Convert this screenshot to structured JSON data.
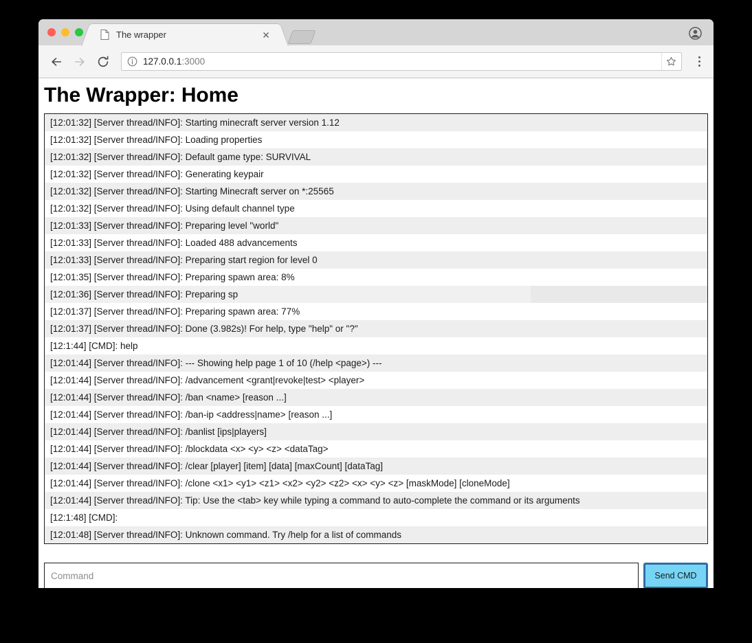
{
  "browser": {
    "tab": {
      "title": "The wrapper",
      "favicon": "document-icon",
      "close": "close-icon"
    },
    "new_tab_label": "new-tab-button",
    "profile": "profile-avatar-icon",
    "nav": {
      "back": "back-arrow-icon",
      "forward": "forward-arrow-icon",
      "reload": "reload-icon"
    },
    "omnibox": {
      "site_info": "info-circle-icon",
      "url_host": "127.0.0.1",
      "url_port": ":3000",
      "bookmark": "star-icon"
    },
    "menu": "three-dot-menu-icon"
  },
  "page": {
    "title": "The Wrapper: Home",
    "console_lines": [
      "[12:01:32] [Server thread/INFO]: Starting minecraft server version 1.12",
      "[12:01:32] [Server thread/INFO]: Loading properties",
      "[12:01:32] [Server thread/INFO]: Default game type: SURVIVAL",
      "[12:01:32] [Server thread/INFO]: Generating keypair",
      "[12:01:32] [Server thread/INFO]: Starting Minecraft server on *:25565",
      "[12:01:32] [Server thread/INFO]: Using default channel type",
      "[12:01:33] [Server thread/INFO]: Preparing level \"world\"",
      "[12:01:33] [Server thread/INFO]: Loaded 488 advancements",
      "[12:01:33] [Server thread/INFO]: Preparing start region for level 0",
      "[12:01:35] [Server thread/INFO]: Preparing spawn area: 8%",
      "[12:01:36] [Server thread/INFO]: Preparing sp",
      "[12:01:37] [Server thread/INFO]: Preparing spawn area: 77%",
      "[12:01:37] [Server thread/INFO]: Done (3.982s)! For help, type \"help\" or \"?\"",
      "[12:1:44] [CMD]: help",
      "[12:01:44] [Server thread/INFO]: --- Showing help page 1 of 10 (/help <page>) ---",
      "[12:01:44] [Server thread/INFO]: /advancement <grant|revoke|test> <player>",
      "[12:01:44] [Server thread/INFO]: /ban <name> [reason ...]",
      "[12:01:44] [Server thread/INFO]: /ban-ip <address|name> [reason ...]",
      "[12:01:44] [Server thread/INFO]: /banlist [ips|players]",
      "[12:01:44] [Server thread/INFO]: /blockdata <x> <y> <z> <dataTag>",
      "[12:01:44] [Server thread/INFO]: /clear [player] [item] [data] [maxCount] [dataTag]",
      "[12:01:44] [Server thread/INFO]: /clone <x1> <y1> <z1> <x2> <y2> <z2> <x> <y> <z> [maskMode] [cloneMode]",
      "[12:01:44] [Server thread/INFO]: Tip: Use the <tab> key while typing a command to auto-complete the command or its arguments",
      "[12:1:48] [CMD]:",
      "[12:01:48] [Server thread/INFO]: Unknown command. Try /help for a list of commands"
    ],
    "partial_line_index": 10,
    "command": {
      "value": "",
      "placeholder": "Command",
      "send_label": "Send CMD"
    }
  },
  "colors": {
    "send_button_fill": "#76d5f5",
    "send_button_border": "#2f6ea5",
    "row_alt": "#eeeeee",
    "backdrop": "#000000"
  }
}
